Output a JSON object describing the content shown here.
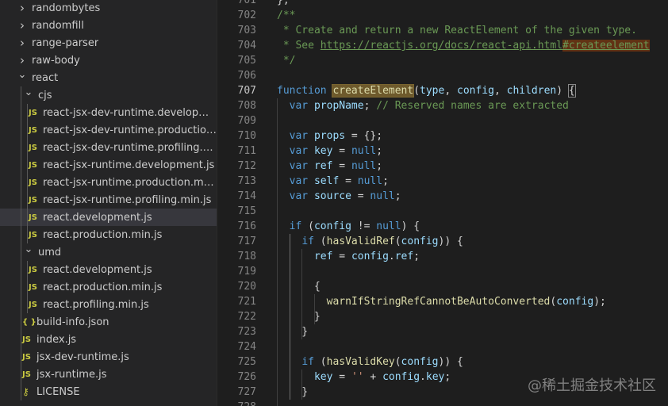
{
  "explorer": {
    "items": [
      {
        "label": "randombytes",
        "type": "folder",
        "expanded": false
      },
      {
        "label": "randomfill",
        "type": "folder",
        "expanded": false
      },
      {
        "label": "range-parser",
        "type": "folder",
        "expanded": false
      },
      {
        "label": "raw-body",
        "type": "folder",
        "expanded": false
      },
      {
        "label": "react",
        "type": "folder",
        "expanded": true
      },
      {
        "label": "cjs",
        "type": "folder",
        "expanded": true
      },
      {
        "label": "react-jsx-dev-runtime.development.js",
        "type": "js"
      },
      {
        "label": "react-jsx-dev-runtime.production.min.js",
        "type": "js"
      },
      {
        "label": "react-jsx-dev-runtime.profiling.min.js",
        "type": "js"
      },
      {
        "label": "react-jsx-runtime.development.js",
        "type": "js"
      },
      {
        "label": "react-jsx-runtime.production.min.js",
        "type": "js"
      },
      {
        "label": "react-jsx-runtime.profiling.min.js",
        "type": "js"
      },
      {
        "label": "react.development.js",
        "type": "js",
        "selected": true
      },
      {
        "label": "react.production.min.js",
        "type": "js"
      },
      {
        "label": "umd",
        "type": "folder",
        "expanded": true
      },
      {
        "label": "react.development.js",
        "type": "js"
      },
      {
        "label": "react.production.min.js",
        "type": "js"
      },
      {
        "label": "react.profiling.min.js",
        "type": "js"
      },
      {
        "label": "build-info.json",
        "type": "json"
      },
      {
        "label": "index.js",
        "type": "js"
      },
      {
        "label": "jsx-dev-runtime.js",
        "type": "js"
      },
      {
        "label": "jsx-runtime.js",
        "type": "js"
      },
      {
        "label": "LICENSE",
        "type": "license"
      }
    ],
    "icons": {
      "js": "JS",
      "json": "{ }",
      "license": "⚷"
    }
  },
  "editor": {
    "current_line": "707",
    "lines": [
      {
        "n": "701",
        "html": "<span>};</span>"
      },
      {
        "n": "702",
        "html": "<span class=\"cm\">/**</span>"
      },
      {
        "n": "703",
        "html": "<span class=\"cm\"> * Create and return a new ReactElement of the given type.</span>"
      },
      {
        "n": "704",
        "html": "<span class=\"cm\"> * See </span><span class=\"lnk\">https://reactjs.org/docs/react-api.html</span><span class=\"lnk hl\">#createelement</span>"
      },
      {
        "n": "705",
        "html": "<span class=\"cm\"> */</span>"
      },
      {
        "n": "706",
        "html": ""
      },
      {
        "n": "707",
        "html": "<span class=\"kw\">function</span> <span class=\"fn hlword\">createElement</span>(<span class=\"var\">type</span>, <span class=\"var\">config</span>, <span class=\"var\">children</span>) <span class=\"bracket\">{</span>"
      },
      {
        "n": "708",
        "html": "  <span class=\"kw\">var</span> <span class=\"var\">propName</span>; <span class=\"cm\">// Reserved names are extracted</span>"
      },
      {
        "n": "709",
        "html": ""
      },
      {
        "n": "710",
        "html": "  <span class=\"kw\">var</span> <span class=\"var\">props</span> = {};"
      },
      {
        "n": "711",
        "html": "  <span class=\"kw\">var</span> <span class=\"var\">key</span> = <span class=\"kw\">null</span>;"
      },
      {
        "n": "712",
        "html": "  <span class=\"kw\">var</span> <span class=\"var\">ref</span> = <span class=\"kw\">null</span>;"
      },
      {
        "n": "713",
        "html": "  <span class=\"kw\">var</span> <span class=\"var\">self</span> = <span class=\"kw\">null</span>;"
      },
      {
        "n": "714",
        "html": "  <span class=\"kw\">var</span> <span class=\"var\">source</span> = <span class=\"kw\">null</span>;"
      },
      {
        "n": "715",
        "html": ""
      },
      {
        "n": "716",
        "html": "  <span class=\"kw\">if</span> (<span class=\"var\">config</span> != <span class=\"kw\">null</span>) {"
      },
      {
        "n": "717",
        "html": "    <span class=\"kw\">if</span> (<span class=\"fn\">hasValidRef</span>(<span class=\"var\">config</span>)) {"
      },
      {
        "n": "718",
        "html": "      <span class=\"var\">ref</span> = <span class=\"var\">config</span>.<span class=\"var\">ref</span>;"
      },
      {
        "n": "719",
        "html": ""
      },
      {
        "n": "720",
        "html": "      {"
      },
      {
        "n": "721",
        "html": "        <span class=\"fn\">warnIfStringRefCannotBeAutoConverted</span>(<span class=\"var\">config</span>);"
      },
      {
        "n": "722",
        "html": "      }"
      },
      {
        "n": "723",
        "html": "    }"
      },
      {
        "n": "724",
        "html": ""
      },
      {
        "n": "725",
        "html": "    <span class=\"kw\">if</span> (<span class=\"fn\">hasValidKey</span>(<span class=\"var\">config</span>)) {"
      },
      {
        "n": "726",
        "html": "      <span class=\"var\">key</span> = <span class=\"str\">''</span> + <span class=\"var\">config</span>.<span class=\"var\">key</span>;"
      },
      {
        "n": "727",
        "html": "    }"
      },
      {
        "n": "728",
        "html": ""
      }
    ]
  },
  "watermark": "@稀土掘金技术社区"
}
